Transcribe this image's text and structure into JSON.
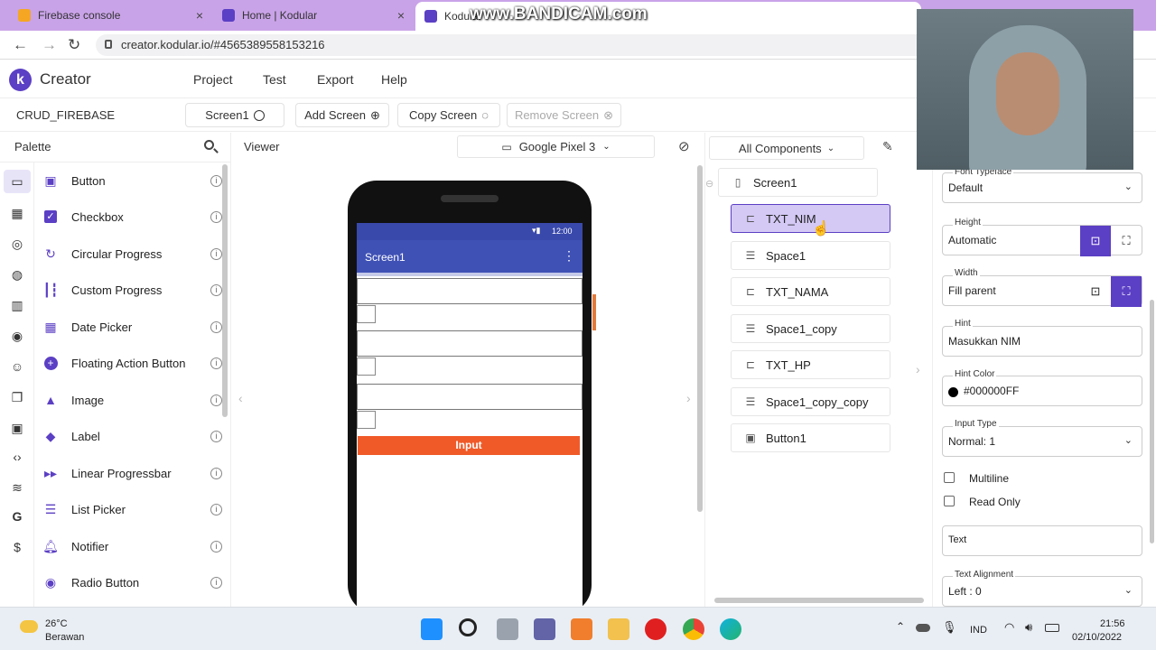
{
  "browser": {
    "tabs": [
      {
        "title": "Firebase console",
        "close": "×"
      },
      {
        "title": "Home | Kodular",
        "close": "×"
      },
      {
        "title": "Kodular",
        "close": "×"
      }
    ],
    "watermark": "www.BANDICAM.com",
    "url": "creator.kodular.io/#4565389558153216",
    "nav": {
      "back": "←",
      "forward": "→",
      "reload": "↻"
    }
  },
  "app": {
    "brand": "Creator",
    "logo": "k",
    "menu": [
      "Project",
      "Test",
      "Export",
      "Help"
    ],
    "project_name": "CRUD_FIREBASE",
    "screen_buttons": {
      "screen1": "Screen1",
      "add_screen": "Add Screen",
      "copy_screen": "Copy Screen",
      "remove_screen": "Remove Screen"
    }
  },
  "palette": {
    "title": "Palette",
    "items": [
      "Button",
      "Checkbox",
      "Circular Progress",
      "Custom Progress",
      "Date Picker",
      "Floating Action Button",
      "Image",
      "Label",
      "Linear Progressbar",
      "List Picker",
      "Notifier",
      "Radio Button"
    ],
    "info_icon": "i"
  },
  "viewer": {
    "title": "Viewer",
    "device": "Google Pixel 3",
    "phone": {
      "time": "12:00",
      "screen_title": "Screen1",
      "menu": "⋮",
      "button_label": "Input"
    }
  },
  "components": {
    "filter": "All Components",
    "root": "Screen1",
    "items": [
      "TXT_NIM",
      "Space1",
      "TXT_NAMA",
      "Space1_copy",
      "TXT_HP",
      "Space1_copy_copy",
      "Button1"
    ],
    "selected": "TXT_NIM"
  },
  "properties": {
    "font_typeface": {
      "label": "Font Typeface",
      "value": "Default"
    },
    "height": {
      "label": "Height",
      "value": "Automatic"
    },
    "width": {
      "label": "Width",
      "value": "Fill parent"
    },
    "hint": {
      "label": "Hint",
      "value": "Masukkan NIM"
    },
    "hint_color": {
      "label": "Hint Color",
      "value": "#000000FF"
    },
    "input_type": {
      "label": "Input Type",
      "value": "Normal: 1"
    },
    "multiline": "Multiline",
    "read_only": "Read Only",
    "text": "Text",
    "text_alignment": {
      "label": "Text Alignment",
      "value": "Left : 0"
    }
  },
  "taskbar": {
    "weather_temp": "26°C",
    "weather_desc": "Berawan",
    "lang": "IND",
    "time": "21:56",
    "date": "02/10/2022"
  },
  "colors": {
    "accent": "#5b3fc4",
    "selected_bg": "#d4c9f5",
    "phone_bar": "#3f51b5",
    "button": "#f05a28",
    "tabbar": "#c9a3e8"
  }
}
